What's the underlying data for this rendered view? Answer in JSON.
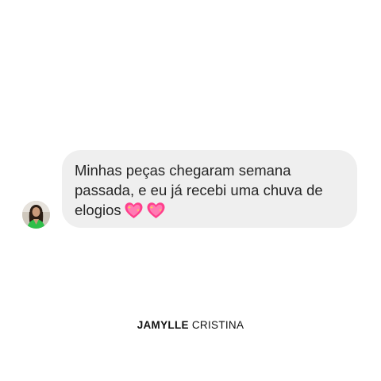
{
  "message": {
    "text": "Minhas peças chegaram semana passada, e eu já recebi uma chuva de elogios",
    "emojis": [
      "sparkling-heart-icon",
      "sparkling-heart-icon"
    ]
  },
  "author": {
    "first_name": "JAMYLLE",
    "last_name": "CRISTINA"
  },
  "colors": {
    "background": "#ffffff",
    "bubble": "#efefef",
    "text": "#262626",
    "heart": "#ff3f8c",
    "avatar_outfit": "#2fbf4a"
  }
}
